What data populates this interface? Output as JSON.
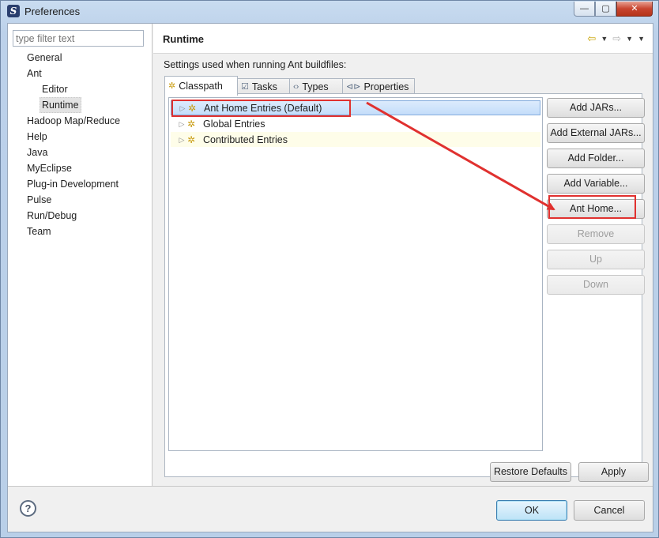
{
  "window": {
    "title": "Preferences",
    "app_icon": "S",
    "minimize_icon": "—",
    "maximize_icon": "▢",
    "close_icon": "✕"
  },
  "filter": {
    "placeholder": "type filter text",
    "value": ""
  },
  "tree": {
    "items": [
      {
        "label": "General",
        "level": 0,
        "selected": false
      },
      {
        "label": "Ant",
        "level": 0,
        "selected": false
      },
      {
        "label": "Editor",
        "level": 1,
        "selected": false
      },
      {
        "label": "Runtime",
        "level": 1,
        "selected": true
      },
      {
        "label": "Hadoop Map/Reduce",
        "level": 0,
        "selected": false
      },
      {
        "label": "Help",
        "level": 0,
        "selected": false
      },
      {
        "label": "Java",
        "level": 0,
        "selected": false
      },
      {
        "label": "MyEclipse",
        "level": 0,
        "selected": false
      },
      {
        "label": "Plug-in Development",
        "level": 0,
        "selected": false
      },
      {
        "label": "Pulse",
        "level": 0,
        "selected": false
      },
      {
        "label": "Run/Debug",
        "level": 0,
        "selected": false
      },
      {
        "label": "Team",
        "level": 0,
        "selected": false
      }
    ]
  },
  "page": {
    "title": "Runtime",
    "description": "Settings used when running Ant buildfiles:",
    "nav": {
      "back_icon": "⇦",
      "forward_icon": "⇨",
      "dropdown_icon": "▼",
      "menu_icon": "▼"
    }
  },
  "tabs": [
    {
      "label": "Classpath",
      "icon": "✲",
      "active": true
    },
    {
      "label": "Tasks",
      "icon": "☑",
      "active": false
    },
    {
      "label": "Types",
      "icon": "‹›",
      "active": false
    },
    {
      "label": "Properties",
      "icon": "⊲⊳",
      "active": false
    }
  ],
  "classpath": {
    "entries": [
      {
        "label": "Ant Home Entries (Default)",
        "selected": true
      },
      {
        "label": "Global Entries",
        "selected": false
      },
      {
        "label": "Contributed Entries",
        "selected": false
      }
    ],
    "expander_icon": "▷",
    "entry_icon": "✲"
  },
  "side_buttons": [
    {
      "label": "Add JARs...",
      "enabled": true
    },
    {
      "label": "Add External JARs...",
      "enabled": true
    },
    {
      "label": "Add Folder...",
      "enabled": true
    },
    {
      "label": "Add Variable...",
      "enabled": true
    },
    {
      "label": "Ant Home...",
      "enabled": true
    },
    {
      "label": "Remove",
      "enabled": false
    },
    {
      "label": "Up",
      "enabled": false
    },
    {
      "label": "Down",
      "enabled": false
    }
  ],
  "page_buttons": {
    "restore_defaults": "Restore Defaults",
    "apply": "Apply"
  },
  "dialog_buttons": {
    "ok": "OK",
    "cancel": "Cancel"
  },
  "help_icon_glyph": "?",
  "annotation_color": "#e0312f"
}
